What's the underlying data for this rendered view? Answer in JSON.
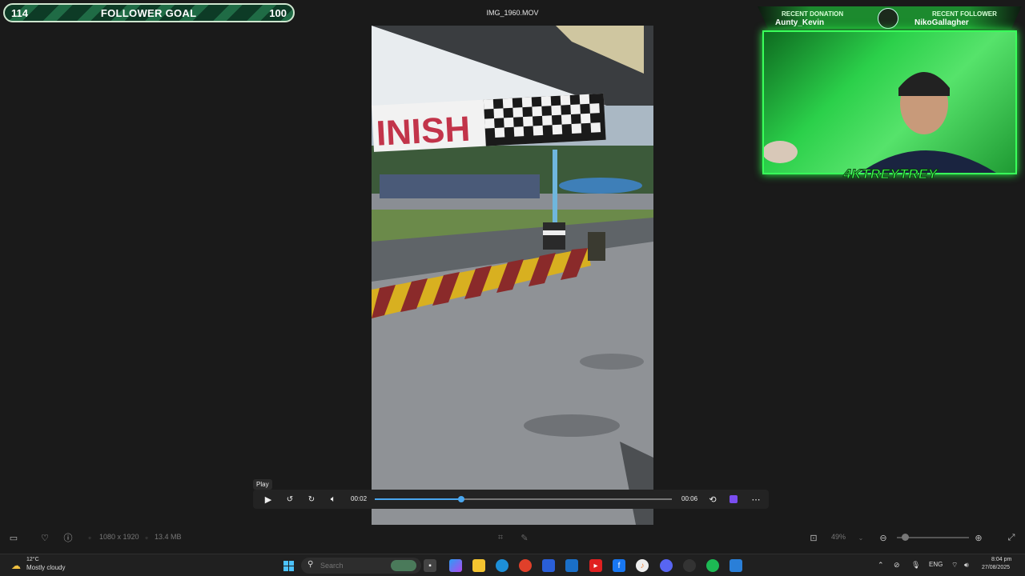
{
  "goal": {
    "current": "114",
    "title": "FOLLOWER GOAL",
    "target": "100"
  },
  "file_title": "IMG_1960.MOV",
  "video": {
    "sign_text": "INISH"
  },
  "cam": {
    "donation_label": "RECENT DONATION",
    "donation_name": "Aunty_Kevin",
    "follower_label": "RECENT FOLLOWER",
    "follower_name": "NikoGallagher",
    "streamer_name": "4KTREYTREY"
  },
  "player": {
    "tooltip": "Play",
    "elapsed": "00:02",
    "duration": "00:06",
    "progress_fraction": 0.29
  },
  "info": {
    "resolution": "1080 x 1920",
    "size": "13.4 MB",
    "zoom": "49%"
  },
  "taskbar": {
    "temp": "12°C",
    "weather": "Mostly cloudy",
    "search_placeholder": "Search",
    "lang": "ENG",
    "time": "8:04 pm",
    "date": "27/08/2025"
  },
  "colors": {
    "accent": "#4aa7ef",
    "overlay_green": "#39ff5a",
    "goal_green": "#1f6b45"
  }
}
